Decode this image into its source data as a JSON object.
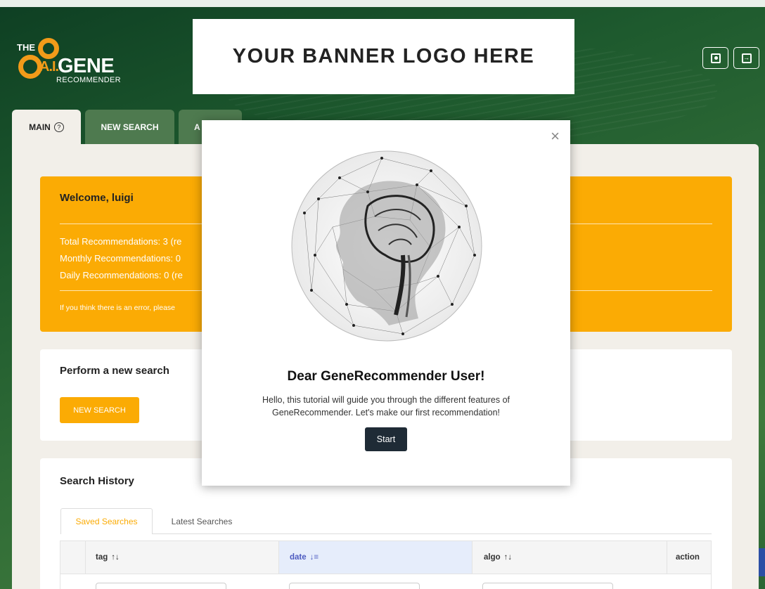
{
  "header": {
    "logo": {
      "the": "THE",
      "ai": "A.I.",
      "gene": "GENE",
      "recommender": "RECOMMENDER"
    },
    "banner_text": "YOUR BANNER LOGO HERE",
    "icons": [
      "user-profile-icon",
      "logout-icon"
    ]
  },
  "tabs": [
    {
      "label": "MAIN",
      "help": "?"
    },
    {
      "label": "NEW SEARCH"
    },
    {
      "label": "A"
    }
  ],
  "welcome": {
    "title": "Welcome, luigi",
    "total": "Total Recommendations: 3 (re",
    "monthly": "Monthly Recommendations: 0",
    "daily": "Daily Recommendations: 0 (re",
    "note": "If you think there is an error, please"
  },
  "search_card": {
    "title": "Perform a new search",
    "button": "NEW SEARCH"
  },
  "history": {
    "title": "Search History",
    "subtabs": [
      "Saved Searches",
      "Latest Searches"
    ],
    "columns": [
      {
        "label": "tag",
        "sort": "↑↓"
      },
      {
        "label": "date",
        "sort": "↓≡"
      },
      {
        "label": "algo",
        "sort": "↑↓"
      },
      {
        "label": "action"
      }
    ]
  },
  "modal": {
    "close": "×",
    "heading": "Dear GeneRecommender User!",
    "body": "Hello, this tutorial will guide you through the different features of GeneRecommender. Let's make our first recommendation!",
    "start_button": "Start"
  },
  "colors": {
    "accent": "#fbab04",
    "dark_button": "#1f2b36",
    "sorted_column": "#4d5bc0"
  }
}
